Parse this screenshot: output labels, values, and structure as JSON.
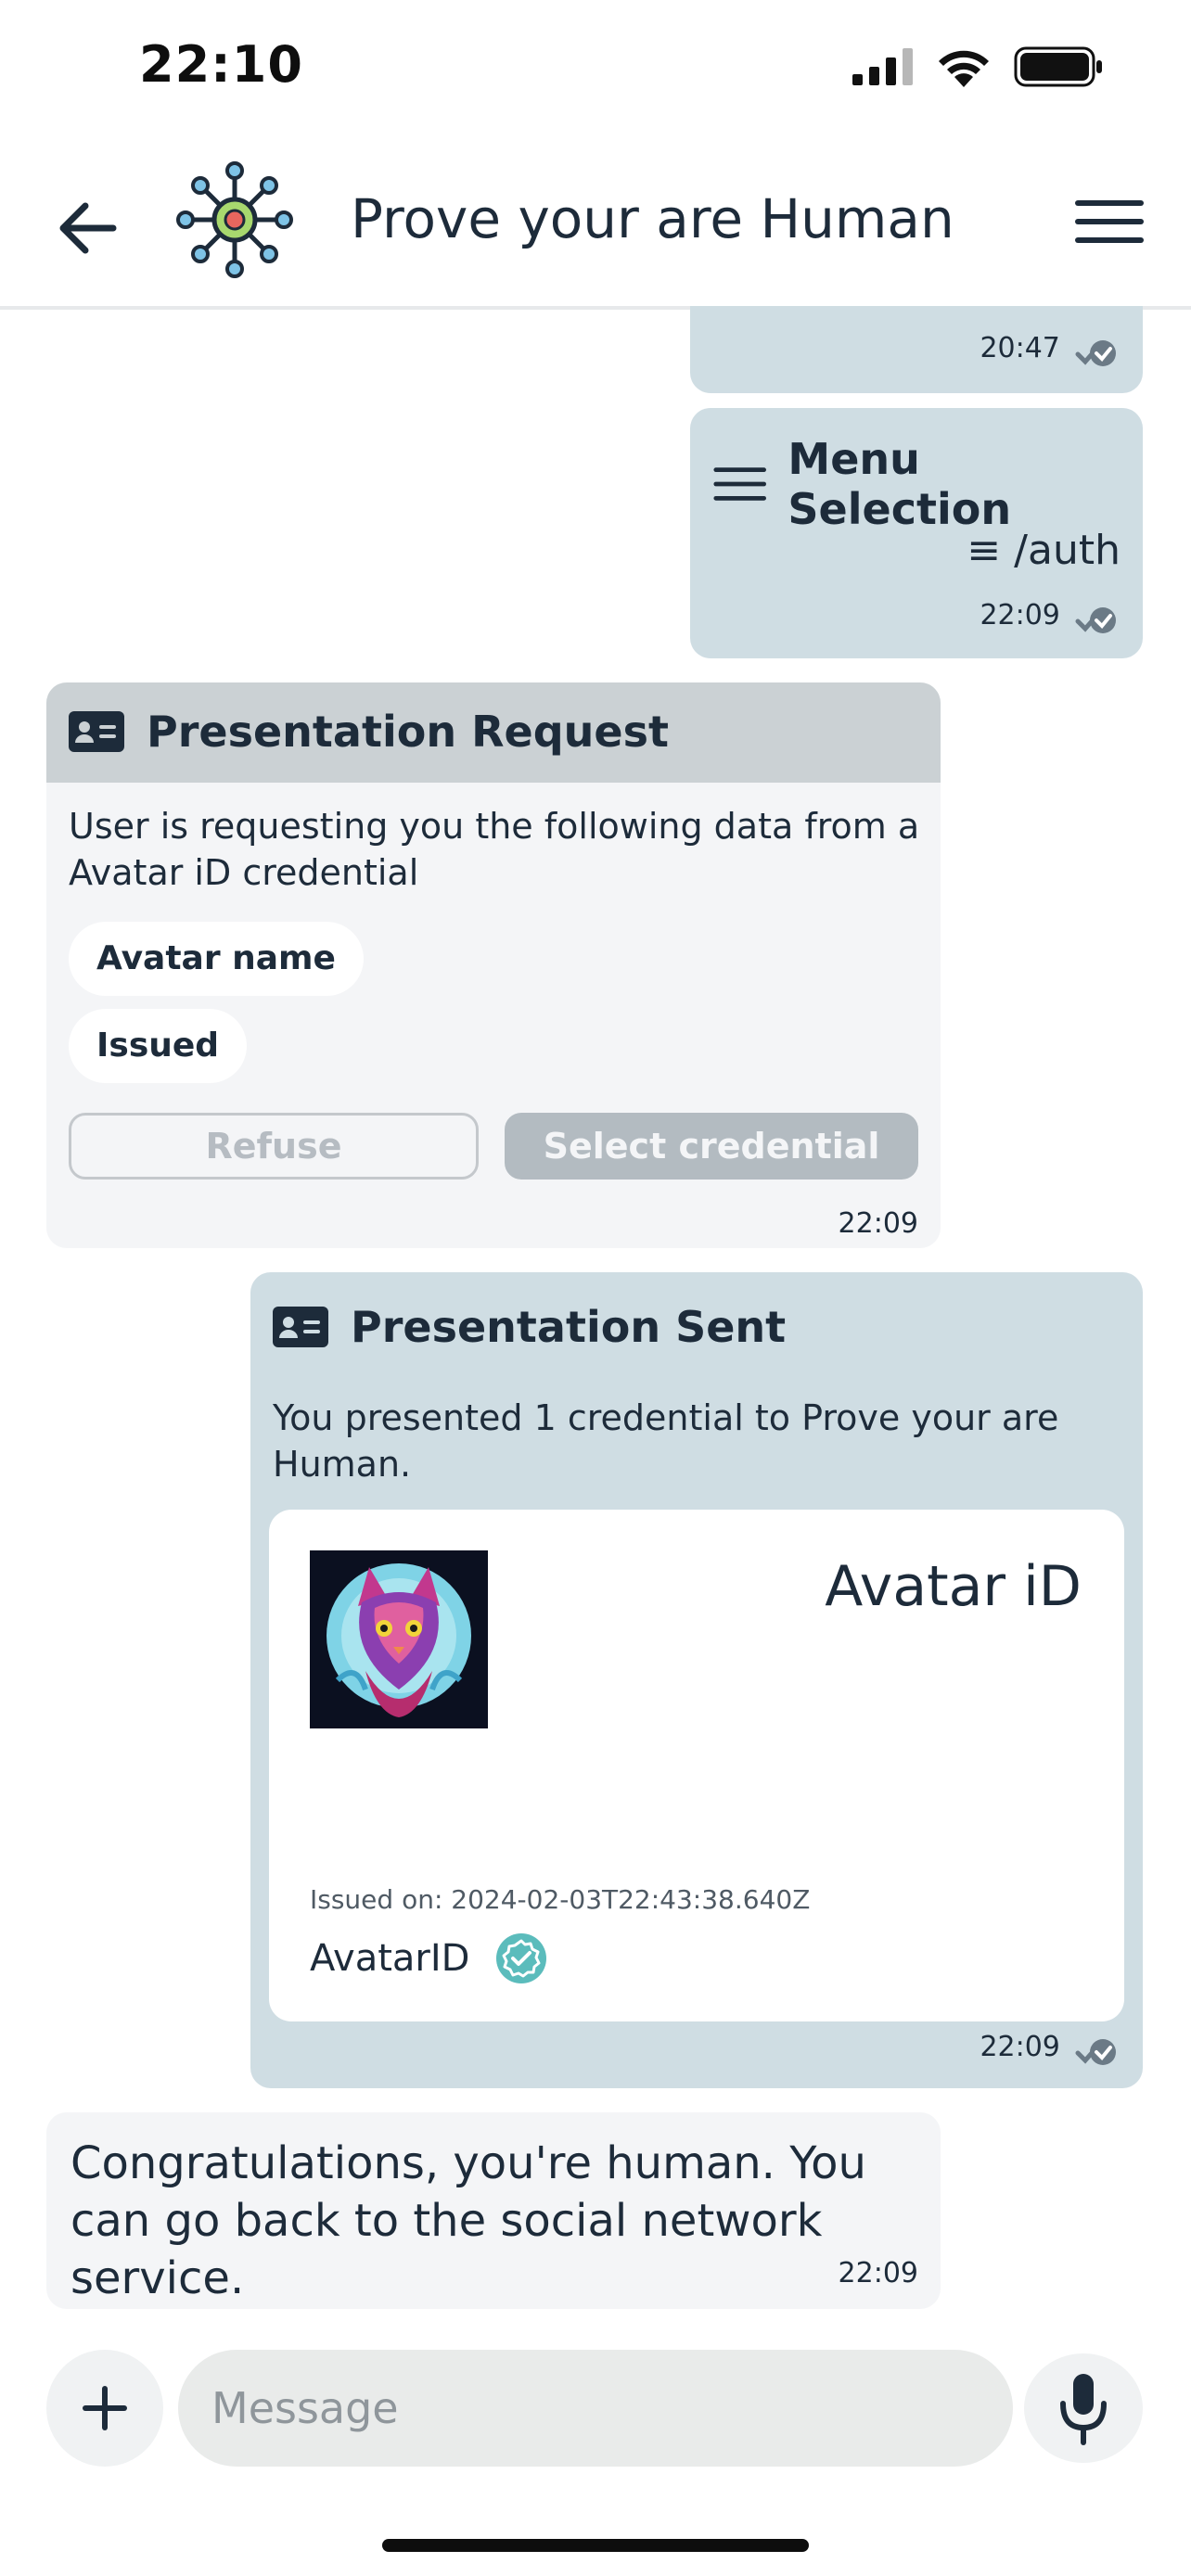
{
  "status_bar": {
    "time": "22:10"
  },
  "header": {
    "title": "Prove your are Human"
  },
  "messages": {
    "prev": {
      "time": "20:47"
    },
    "menu_selection": {
      "title": "Menu Selection",
      "command": "≡ /auth",
      "time": "22:09"
    },
    "presentation_request": {
      "title": "Presentation Request",
      "text": "User is requesting you the following data from a Avatar iD credential",
      "attributes": [
        "Avatar name",
        "Issued"
      ],
      "refuse_label": "Refuse",
      "select_label": "Select credential",
      "time": "22:09"
    },
    "presentation_sent": {
      "title": "Presentation Sent",
      "text": "You presented 1 credential to Prove your are Human.",
      "credential": {
        "name": "Avatar iD",
        "issued": "Issued on: 2024-02-03T22:43:38.640Z",
        "issuer": "AvatarID"
      },
      "time": "22:09"
    },
    "congrats": {
      "text": "Congratulations, you're human. You can go back to the social network service.",
      "time": "22:09"
    }
  },
  "composer": {
    "placeholder": "Message"
  },
  "colors": {
    "outgoing_bubble": "#cfdde3",
    "incoming_bubble": "#f4f5f7",
    "request_header": "#cbd1d4",
    "text": "#1d2b3a",
    "verified_badge": "#5bbcbc"
  }
}
